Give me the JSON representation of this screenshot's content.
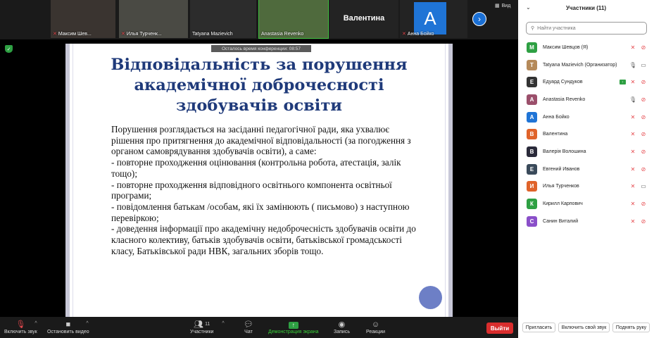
{
  "top_strip": {
    "tiles": [
      {
        "name": "Максим Шев..."
      },
      {
        "name": "Илья Турченк..."
      },
      {
        "name": "Tatyana Mazievich"
      },
      {
        "name": "Anastasia Revenko"
      },
      {
        "name": "Валентина"
      },
      {
        "name": "Анна Бойко",
        "initial": "A"
      }
    ],
    "view_label": "Вид"
  },
  "timer_text": "Осталось время конференции: 08:57",
  "slide": {
    "title": "Відповідальність за порушення академічної доброчесності здобувачів освіти",
    "paragraphs": [
      "Порушення розглядається на засіданні педагогічної ради, яка ухвалює рішення про притягнення до академічної відповідальності (за погодження з органом самоврядування здобувачів освіти), а саме:",
      "- повторне проходження оцінювання (контрольна робота, атестація, залік тощо);",
      "- повторне проходження відповідного освітнього компонента освітньої програми;",
      "- повідомлення батькам /особам, які їх замінюють ( письмово) з наступною перевіркою;",
      "- доведення інформації про академічну недоброчесність здобувачів освіти до класного колективу, батьків здобувачів освіти, батьківської громадськості класу, Батьківської ради НВК, загальних зборів тощо."
    ]
  },
  "toolbar": {
    "unmute": "Включить звук",
    "stop_video": "Остановить видео",
    "participants": "Участники",
    "participants_count": "11",
    "chat": "Чат",
    "share": "Демонстрация экрана",
    "record": "Запись",
    "reactions": "Реакции",
    "leave": "Выйти"
  },
  "panel": {
    "title": "Участники (11)",
    "search_placeholder": "Найти участника",
    "participants": [
      {
        "name": "Максим Шевцов (Я)",
        "initial": "M",
        "color": "#2ea043",
        "mic": "off",
        "cam": "off"
      },
      {
        "name": "Tatyana Mazievich (Организатор)",
        "initial": "T",
        "color": "#b58a5a",
        "mic": "on",
        "cam": "on"
      },
      {
        "name": "Едуард Сундуков",
        "initial": "Е",
        "color": "#333333",
        "mic": "off",
        "cam": "off",
        "sharing": true
      },
      {
        "name": "Anastasia Revenko",
        "initial": "A",
        "color": "#9b4f6b",
        "mic": "on",
        "cam": "off"
      },
      {
        "name": "Анна Бойко",
        "initial": "А",
        "color": "#1f74d6",
        "mic": "off",
        "cam": "off"
      },
      {
        "name": "Валентина",
        "initial": "В",
        "color": "#e0632a",
        "mic": "off",
        "cam": "off"
      },
      {
        "name": "Валерія Волошина",
        "initial": "В",
        "color": "#2a2a3a",
        "mic": "off",
        "cam": "off"
      },
      {
        "name": "Евгений Иванов",
        "initial": "Е",
        "color": "#3a4a5a",
        "mic": "off",
        "cam": "off"
      },
      {
        "name": "Илья Турченков",
        "initial": "И",
        "color": "#e0632a",
        "mic": "off",
        "cam": "on"
      },
      {
        "name": "Кирилл Карпович",
        "initial": "К",
        "color": "#2ea043",
        "mic": "off",
        "cam": "off"
      },
      {
        "name": "Санин Виталий",
        "initial": "С",
        "color": "#8a4fc9",
        "mic": "off",
        "cam": "off"
      }
    ],
    "footer": {
      "invite": "Пригласить",
      "unmute_me": "Включить свой звук",
      "raise_hand": "Поднять руку"
    }
  }
}
